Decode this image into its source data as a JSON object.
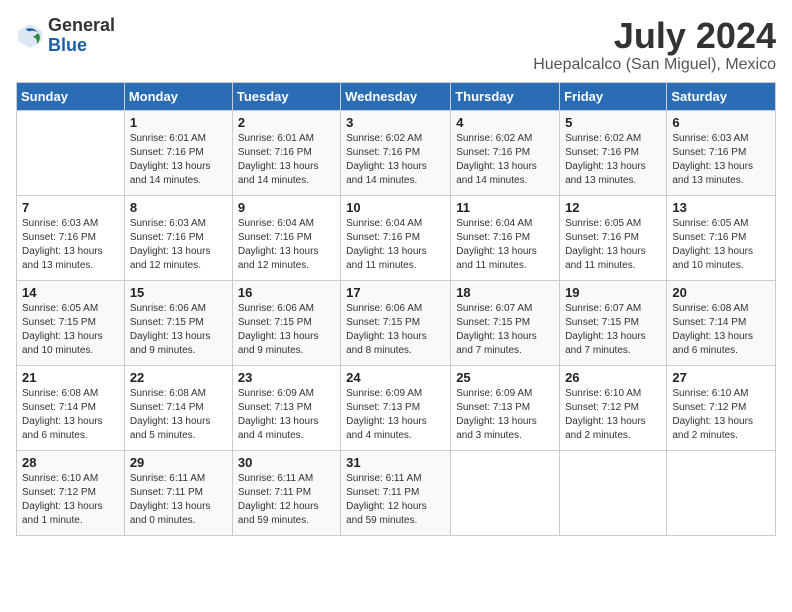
{
  "header": {
    "logo_general": "General",
    "logo_blue": "Blue",
    "month_year": "July 2024",
    "location": "Huepalcalco (San Miguel), Mexico"
  },
  "days_of_week": [
    "Sunday",
    "Monday",
    "Tuesday",
    "Wednesday",
    "Thursday",
    "Friday",
    "Saturday"
  ],
  "weeks": [
    [
      {
        "day": "",
        "info": ""
      },
      {
        "day": "1",
        "info": "Sunrise: 6:01 AM\nSunset: 7:16 PM\nDaylight: 13 hours\nand 14 minutes."
      },
      {
        "day": "2",
        "info": "Sunrise: 6:01 AM\nSunset: 7:16 PM\nDaylight: 13 hours\nand 14 minutes."
      },
      {
        "day": "3",
        "info": "Sunrise: 6:02 AM\nSunset: 7:16 PM\nDaylight: 13 hours\nand 14 minutes."
      },
      {
        "day": "4",
        "info": "Sunrise: 6:02 AM\nSunset: 7:16 PM\nDaylight: 13 hours\nand 14 minutes."
      },
      {
        "day": "5",
        "info": "Sunrise: 6:02 AM\nSunset: 7:16 PM\nDaylight: 13 hours\nand 13 minutes."
      },
      {
        "day": "6",
        "info": "Sunrise: 6:03 AM\nSunset: 7:16 PM\nDaylight: 13 hours\nand 13 minutes."
      }
    ],
    [
      {
        "day": "7",
        "info": "Sunrise: 6:03 AM\nSunset: 7:16 PM\nDaylight: 13 hours\nand 13 minutes."
      },
      {
        "day": "8",
        "info": "Sunrise: 6:03 AM\nSunset: 7:16 PM\nDaylight: 13 hours\nand 12 minutes."
      },
      {
        "day": "9",
        "info": "Sunrise: 6:04 AM\nSunset: 7:16 PM\nDaylight: 13 hours\nand 12 minutes."
      },
      {
        "day": "10",
        "info": "Sunrise: 6:04 AM\nSunset: 7:16 PM\nDaylight: 13 hours\nand 11 minutes."
      },
      {
        "day": "11",
        "info": "Sunrise: 6:04 AM\nSunset: 7:16 PM\nDaylight: 13 hours\nand 11 minutes."
      },
      {
        "day": "12",
        "info": "Sunrise: 6:05 AM\nSunset: 7:16 PM\nDaylight: 13 hours\nand 11 minutes."
      },
      {
        "day": "13",
        "info": "Sunrise: 6:05 AM\nSunset: 7:16 PM\nDaylight: 13 hours\nand 10 minutes."
      }
    ],
    [
      {
        "day": "14",
        "info": "Sunrise: 6:05 AM\nSunset: 7:15 PM\nDaylight: 13 hours\nand 10 minutes."
      },
      {
        "day": "15",
        "info": "Sunrise: 6:06 AM\nSunset: 7:15 PM\nDaylight: 13 hours\nand 9 minutes."
      },
      {
        "day": "16",
        "info": "Sunrise: 6:06 AM\nSunset: 7:15 PM\nDaylight: 13 hours\nand 9 minutes."
      },
      {
        "day": "17",
        "info": "Sunrise: 6:06 AM\nSunset: 7:15 PM\nDaylight: 13 hours\nand 8 minutes."
      },
      {
        "day": "18",
        "info": "Sunrise: 6:07 AM\nSunset: 7:15 PM\nDaylight: 13 hours\nand 7 minutes."
      },
      {
        "day": "19",
        "info": "Sunrise: 6:07 AM\nSunset: 7:15 PM\nDaylight: 13 hours\nand 7 minutes."
      },
      {
        "day": "20",
        "info": "Sunrise: 6:08 AM\nSunset: 7:14 PM\nDaylight: 13 hours\nand 6 minutes."
      }
    ],
    [
      {
        "day": "21",
        "info": "Sunrise: 6:08 AM\nSunset: 7:14 PM\nDaylight: 13 hours\nand 6 minutes."
      },
      {
        "day": "22",
        "info": "Sunrise: 6:08 AM\nSunset: 7:14 PM\nDaylight: 13 hours\nand 5 minutes."
      },
      {
        "day": "23",
        "info": "Sunrise: 6:09 AM\nSunset: 7:13 PM\nDaylight: 13 hours\nand 4 minutes."
      },
      {
        "day": "24",
        "info": "Sunrise: 6:09 AM\nSunset: 7:13 PM\nDaylight: 13 hours\nand 4 minutes."
      },
      {
        "day": "25",
        "info": "Sunrise: 6:09 AM\nSunset: 7:13 PM\nDaylight: 13 hours\nand 3 minutes."
      },
      {
        "day": "26",
        "info": "Sunrise: 6:10 AM\nSunset: 7:12 PM\nDaylight: 13 hours\nand 2 minutes."
      },
      {
        "day": "27",
        "info": "Sunrise: 6:10 AM\nSunset: 7:12 PM\nDaylight: 13 hours\nand 2 minutes."
      }
    ],
    [
      {
        "day": "28",
        "info": "Sunrise: 6:10 AM\nSunset: 7:12 PM\nDaylight: 13 hours\nand 1 minute."
      },
      {
        "day": "29",
        "info": "Sunrise: 6:11 AM\nSunset: 7:11 PM\nDaylight: 13 hours\nand 0 minutes."
      },
      {
        "day": "30",
        "info": "Sunrise: 6:11 AM\nSunset: 7:11 PM\nDaylight: 12 hours\nand 59 minutes."
      },
      {
        "day": "31",
        "info": "Sunrise: 6:11 AM\nSunset: 7:11 PM\nDaylight: 12 hours\nand 59 minutes."
      },
      {
        "day": "",
        "info": ""
      },
      {
        "day": "",
        "info": ""
      },
      {
        "day": "",
        "info": ""
      }
    ]
  ]
}
